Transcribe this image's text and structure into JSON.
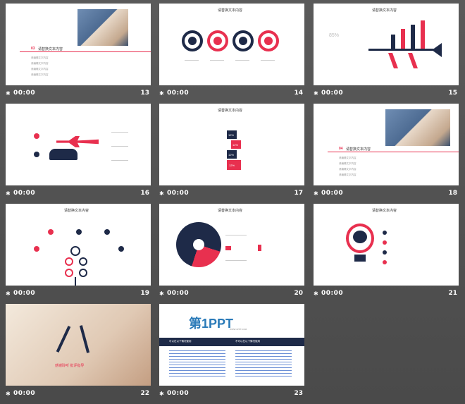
{
  "colors": {
    "accent": "#e8304f",
    "navy": "#1e2a48",
    "bg": "#555555"
  },
  "footer_icon": "star-icon",
  "slides": [
    {
      "num": "13",
      "time": "00:00",
      "section_label": "03",
      "section_title": "请替换文本内容",
      "lines": [
        "请编辑文字内容",
        "请编辑文字内容",
        "请编辑文字内容",
        "请编辑文字内容"
      ]
    },
    {
      "num": "14",
      "time": "00:00",
      "title": "请替换文本内容"
    },
    {
      "num": "15",
      "time": "00:00",
      "title": "请替换文本内容",
      "percent": "85%"
    },
    {
      "num": "16",
      "time": "00:00"
    },
    {
      "num": "17",
      "time": "00:00",
      "title": "请替换文本内容",
      "blocks": [
        "12%",
        "12%",
        "12%",
        "12%"
      ]
    },
    {
      "num": "18",
      "time": "00:00",
      "section_label": "04",
      "section_title": "请替换文本内容",
      "lines": [
        "请编辑文字内容",
        "请编辑文字内容",
        "请编辑文字内容",
        "请编辑文字内容"
      ]
    },
    {
      "num": "19",
      "time": "00:00",
      "title": "请替换文本内容"
    },
    {
      "num": "20",
      "time": "00:00",
      "title": "请替换文本内容"
    },
    {
      "num": "21",
      "time": "00:00",
      "title": "请替换文本内容"
    },
    {
      "num": "22",
      "time": "00:00",
      "caption": "感谢聆听 批评指导"
    },
    {
      "num": "23",
      "time": "00:00",
      "logo": "第1PPT",
      "logo_sub": "WWW.1PPT.COM",
      "col1_head": "可以在以下情况使用",
      "col2_head": "不可以在以下情况使用"
    }
  ]
}
